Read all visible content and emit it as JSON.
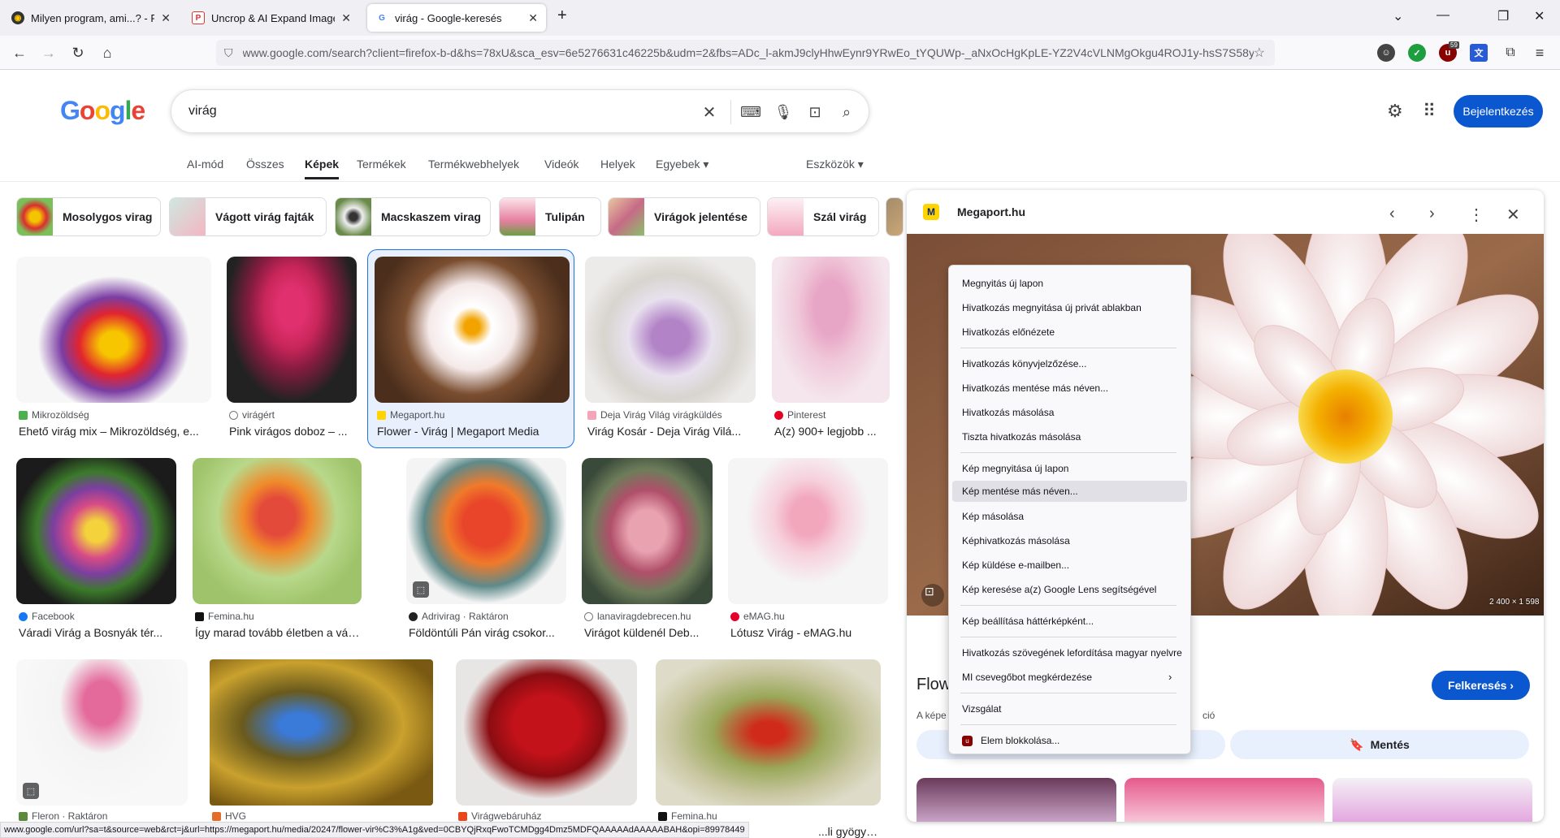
{
  "browser": {
    "tabs": [
      {
        "title": "Milyen program, ami...? - PROH",
        "active": false
      },
      {
        "title": "Uncrop & AI Expand Images | F",
        "active": false
      },
      {
        "title": "virág - Google-keresés",
        "active": true
      }
    ],
    "url": "www.google.com/search?client=firefox-b-d&hs=78xU&sca_esv=6e5276631c46225b&udm=2&fbs=ADc_l-akmJ9clyHhwEynr9YRwEo_tYQUWp-_aNxOcHgKpLE-YZ2V4cVLNMgOkgu4ROJ1y-hsS7S58y",
    "ext_badge": "59"
  },
  "google": {
    "logo": "Google",
    "query": "virág",
    "signin": "Bejelentkezés",
    "nav": [
      "AI-mód",
      "Összes",
      "Képek",
      "Termékek",
      "Termékwebhelyek",
      "Videók",
      "Helyek",
      "Egyebek ▾"
    ],
    "tools": "Eszközök ▾",
    "chips": [
      "Mosolygos virag",
      "Vágott virág fajták",
      "Macskaszem virag",
      "Tulipán",
      "Virágok jelentése",
      "Szál virág"
    ]
  },
  "results": [
    {
      "source": "Mikrozöldség",
      "title": "Ehető virág mix – Mikrozöldség, e..."
    },
    {
      "source": "virágért",
      "title": "Pink virágos doboz – ..."
    },
    {
      "source": "Megaport.hu",
      "title": "Flower - Virág | Megaport Media"
    },
    {
      "source": "Deja Virág Világ virágküldés",
      "title": "Virág Kosár - Deja Virág Vilá..."
    },
    {
      "source": "Pinterest",
      "title": "A(z) 900+ legjobb ..."
    },
    {
      "source": "Facebook",
      "title": "Váradi Virág a Bosnyák tér..."
    },
    {
      "source": "Femina.hu",
      "title": "Így marad tovább életben a vágott..."
    },
    {
      "source": "Adrivirag · Raktáron",
      "title": "Földöntúli Pán virág csokor..."
    },
    {
      "source": "lanaviragdebrecen.hu",
      "title": "Virágot küldenél Deb..."
    },
    {
      "source": "eMAG.hu",
      "title": "Lótusz Virág - eMAG.hu"
    },
    {
      "source": "Fleron · Raktáron",
      "title": ""
    },
    {
      "source": "HVG",
      "title": ""
    },
    {
      "source": "Virágwebáruház",
      "title": ""
    },
    {
      "source": "Femina.hu",
      "title": "...li gyögyh..."
    }
  ],
  "panel": {
    "site": "Megaport.hu",
    "dims": "2 400 × 1 598",
    "title_partial": "Flow",
    "desc_left": "A képe",
    "desc_right": "ció",
    "search_button": "Felkeresés ›",
    "save_button": "Mentés"
  },
  "context_menu": [
    "Megnyitás új lapon",
    "Hivatkozás megnyitása új privát ablakban",
    "Hivatkozás előnézete",
    "Hivatkozás könyvjelzőzése...",
    "Hivatkozás mentése más néven...",
    "Hivatkozás másolása",
    "Tiszta hivatkozás másolása",
    "Kép megnyitása új lapon",
    "Kép mentése más néven...",
    "Kép másolása",
    "Képhivatkozás másolása",
    "Kép küldése e-mailben...",
    "Kép keresése a(z) Google Lens segítségével",
    "Kép beállítása háttérképként...",
    "Hivatkozás szövegének lefordítása magyar nyelvre",
    "MI csevegőbot megkérdezése",
    "Vizsgálat",
    "Elem blokkolása..."
  ],
  "status_url": "www.google.com/url?sa=t&source=web&rct=j&url=https://megaport.hu/media/20247/flower-vir%C3%A1g&ved=0CBYQjRxqFwoTCMDgg4Dmz5MDFQAAAAAdAAAAABAH&opi=89978449"
}
